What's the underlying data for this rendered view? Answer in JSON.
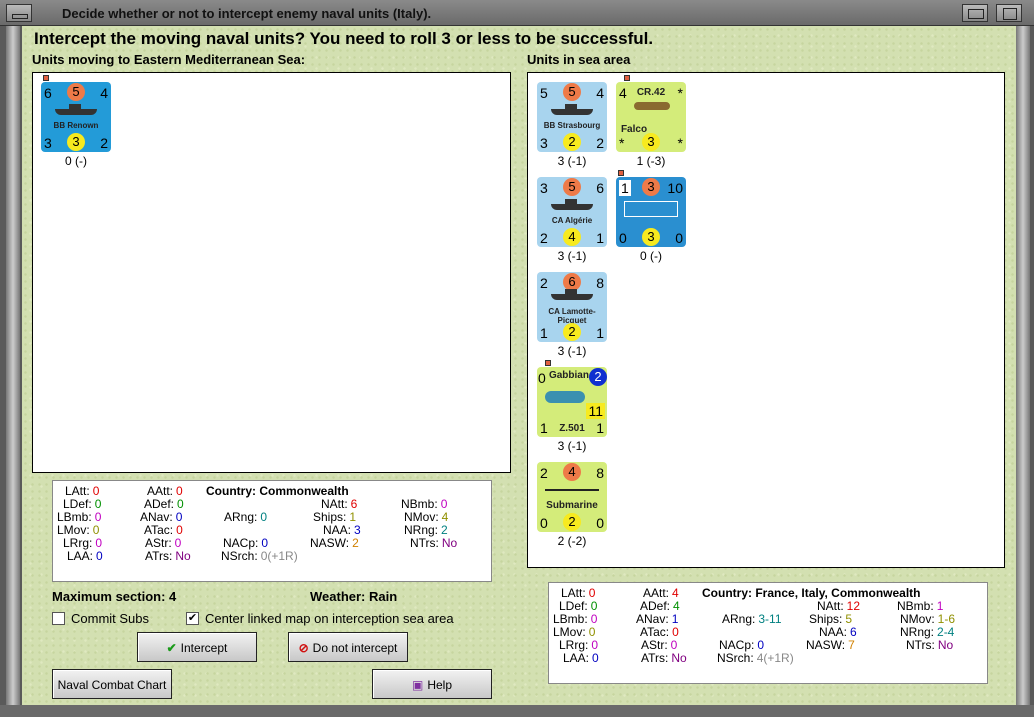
{
  "window": {
    "title": "Decide whether or not to intercept enemy naval units (Italy)."
  },
  "heading": "Intercept the moving naval units?  You need to roll 3 or less to be successful.",
  "left": {
    "title": "Units moving to Eastern Mediterranean Sea:",
    "units": [
      {
        "name": "BB Renown",
        "tl": "6",
        "top": "5",
        "tr": "4",
        "bl": "3",
        "bot": "3",
        "br": "2",
        "label": "0 (-)"
      }
    ]
  },
  "right": {
    "title": "Units in sea area",
    "units": [
      {
        "name": "BB Strasbourg",
        "tl": "5",
        "top": "5",
        "tr": "4",
        "bl": "3",
        "bot": "2",
        "br": "2",
        "label": "3 (-1)"
      },
      {
        "name": "Falco",
        "type": "CR.42",
        "tl": "4",
        "tr": "*",
        "bl": "*",
        "bot": "3",
        "br": "*",
        "label": "1 (-3)"
      },
      {
        "name": "CA Algérie",
        "tl": "3",
        "top": "5",
        "tr": "6",
        "bl": "2",
        "bot": "4",
        "br": "1",
        "label": "3 (-1)"
      },
      {
        "name": "",
        "tl": "1",
        "top": "3",
        "tr": "10",
        "bl": "0",
        "bot": "3",
        "br": "0",
        "label": "0 (-)"
      },
      {
        "name": "CA Lamotte-Picquet",
        "tl": "2",
        "top": "6",
        "tr": "8",
        "bl": "1",
        "bot": "2",
        "br": "1",
        "label": "3 (-1)"
      },
      {
        "name": "Gabbiano",
        "type": "Z.501",
        "tl": "0",
        "topright": "2",
        "midright": "11",
        "bl": "1",
        "br": "1",
        "label": "3 (-1)"
      },
      {
        "name": "Submarine",
        "tl": "2",
        "top": "4",
        "tr": "8",
        "bl": "0",
        "bot": "2",
        "br": "0",
        "label": "2 (-2)"
      }
    ]
  },
  "left_stats": {
    "country_label": "Country:",
    "country": "Commonwealth",
    "latt": "0",
    "ldef": "0",
    "lbmb": "0",
    "lmov": "0",
    "lrng": "0",
    "laa": "0",
    "aatt": "0",
    "adef": "0",
    "anav": "0",
    "atac": "0",
    "astr": "0",
    "atrs": "No",
    "arng": "0",
    "nacp": "0",
    "natt": "6",
    "ships": "1",
    "naa": "3",
    "nasw": "2",
    "nsrch": "0(+1R)",
    "nbmb": "0",
    "nmov": "4",
    "nrng": "2",
    "ntrs": "No"
  },
  "right_stats": {
    "country_label": "Country:",
    "country": "France, Italy, Commonwealth",
    "latt": "0",
    "ldef": "0",
    "lbmb": "0",
    "lmov": "0",
    "lrng": "0",
    "laa": "0",
    "aatt": "4",
    "adef": "4",
    "anav": "1",
    "atac": "0",
    "astr": "0",
    "atrs": "No",
    "arng": "3-11",
    "nacp": "0",
    "natt": "12",
    "ships": "5",
    "naa": "6",
    "nasw": "7",
    "nsrch": "4(+1R)",
    "nbmb": "1",
    "nmov": "1-6",
    "nrng": "2-4",
    "ntrs": "No"
  },
  "labels": {
    "latt": "LAtt:",
    "ldef": "LDef:",
    "lbmb": "LBmb:",
    "lmov": "LMov:",
    "lrng": "LRrg:",
    "laa": "LAA:",
    "aatt": "AAtt:",
    "adef": "ADef:",
    "anav": "ANav:",
    "atac": "ATac:",
    "astr": "AStr:",
    "atrs": "ATrs:",
    "arng": "ARng:",
    "nacp": "NACp:",
    "natt": "NAtt:",
    "ships": "Ships:",
    "naa": "NAA:",
    "nasw": "NASW:",
    "nsrch": "NSrch:",
    "nbmb": "NBmb:",
    "nmov": "NMov:",
    "nrng": "NRng:",
    "ntrs": "NTrs:"
  },
  "max_section": "Maximum section: 4",
  "weather": "Weather:  Rain",
  "commit_subs": {
    "label": "Commit Subs",
    "checked": false
  },
  "center_map": {
    "label": "Center linked map on interception sea area",
    "checked": true
  },
  "buttons": {
    "intercept": "Intercept",
    "no_intercept": "Do not intercept",
    "chart": "Naval Combat Chart",
    "help": "Help"
  },
  "colors": {
    "latt": "#e00000",
    "ldef": "#009000",
    "lbmb": "#c000c0",
    "lmov": "#909000",
    "lrng": "#c000c0",
    "laa": "#0000c0",
    "nsrch": "#888888",
    "arng": "#008080",
    "nasw": "#d08000",
    "ntrs": "#800080"
  }
}
